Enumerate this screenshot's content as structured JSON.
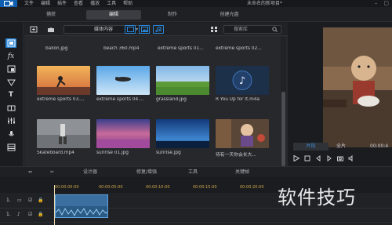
{
  "menu": {
    "items": [
      "文件",
      "编辑",
      "插件",
      "查看",
      "播放",
      "工具",
      "帮助"
    ],
    "project_title": "未命名的新项目*"
  },
  "modes": {
    "tabs": [
      {
        "label": "捕获",
        "active": false
      },
      {
        "label": "编辑",
        "active": true
      },
      {
        "label": "制作",
        "active": false
      },
      {
        "label": "创建光盘",
        "active": false
      }
    ]
  },
  "library": {
    "filter_label": "媒体内容",
    "search_placeholder": "搜索库",
    "top_row_captions": [
      "ballon.jpg",
      "beach 360.mp4",
      "extreme sports 01...",
      "extreme sports 02..."
    ],
    "items": [
      {
        "name": "extreme sports 03....",
        "kind": "skate"
      },
      {
        "name": "extreme sports 04....",
        "kind": "sky"
      },
      {
        "name": "grassland.jpg",
        "kind": "grass"
      },
      {
        "name": "R You Up for It.m4a",
        "kind": "audio"
      },
      {
        "name": "Skateboard.mp4",
        "kind": "skateboard"
      },
      {
        "name": "sunrise 01.jpg",
        "kind": "sunrise1"
      },
      {
        "name": "sunrise.jpg",
        "kind": "sunrise2"
      },
      {
        "name": "待有一天你会长大...",
        "kind": "cartoon"
      }
    ]
  },
  "preview": {
    "tab_clip": "片段",
    "tab_full": "全片",
    "timecode": "00:00:4"
  },
  "timeline_toolbar": {
    "designer": "设计器",
    "fix": "修复/增强",
    "tools": "工具",
    "keyframe": "关键帧"
  },
  "ruler": {
    "ticks": [
      "00:00:00:00",
      "00:00:05:00",
      "00:00:10:00",
      "00:00:15:00",
      "00:00:20:00"
    ]
  },
  "tracks": [
    {
      "label": "1."
    },
    {
      "label": "1."
    }
  ],
  "watermark": "软件技巧",
  "colors": {
    "accent": "#2a86d8",
    "clip": "#2d5f8f",
    "ruler_text": "#d2a64a"
  }
}
